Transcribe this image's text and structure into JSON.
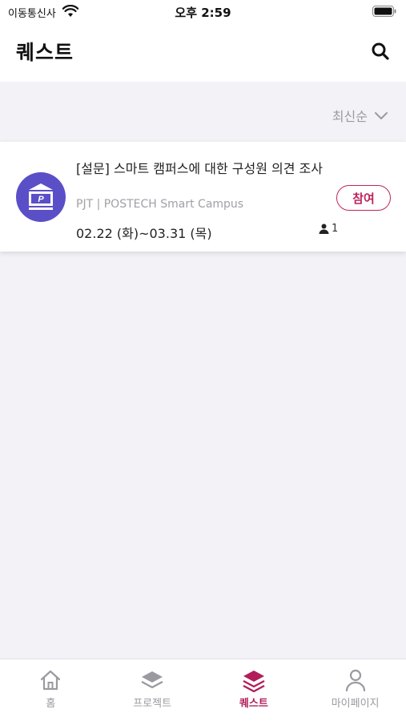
{
  "status_bar": {
    "carrier": "이동통신사",
    "time": "오후 2:59"
  },
  "header": {
    "title": "퀘스트"
  },
  "sort": {
    "label": "최신순"
  },
  "quests": [
    {
      "title": "[설문] 스마트 캠퍼스에 대한 구성원 의견 조사",
      "org": "PJT | POSTECH Smart Campus",
      "date_range": "02.22 (화)~03.31 (목)",
      "participants": "1",
      "action_label": "참여"
    }
  ],
  "tabs": [
    {
      "label": "홈",
      "icon": "home-icon"
    },
    {
      "label": "프로젝트",
      "icon": "layers-icon"
    },
    {
      "label": "퀘스트",
      "icon": "stack-icon"
    },
    {
      "label": "마이페이지",
      "icon": "person-icon"
    }
  ],
  "colors": {
    "accent": "#b01f5a",
    "avatar_bg": "#5b4fc8",
    "background": "#f2f2f7"
  }
}
